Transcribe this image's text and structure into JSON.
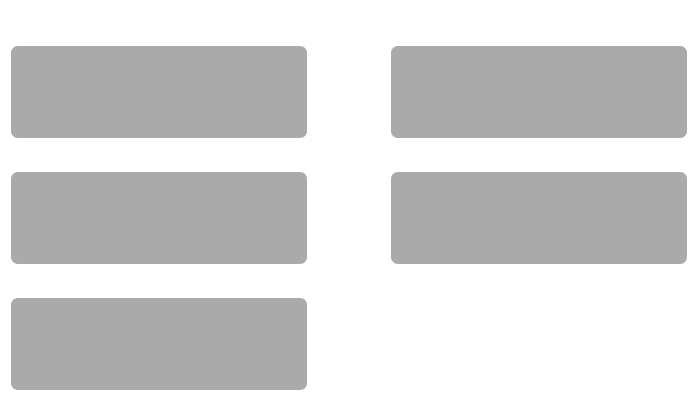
{
  "colors": {
    "background": "#ffffff",
    "card": "#aaaaaa"
  },
  "cards": [
    {
      "label": ""
    },
    {
      "label": ""
    },
    {
      "label": ""
    },
    {
      "label": ""
    },
    {
      "label": ""
    }
  ]
}
